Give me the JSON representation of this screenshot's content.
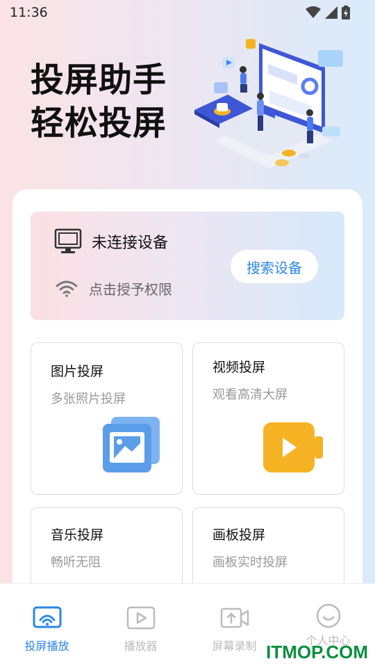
{
  "status_bar": {
    "time": "11:36"
  },
  "hero": {
    "line1": "投屏助手",
    "line2": "轻松投屏"
  },
  "device_panel": {
    "status": "未连接设备",
    "permission": "点击授予权限",
    "search_button": "搜索设备"
  },
  "features": [
    {
      "title": "图片投屏",
      "subtitle": "多张照片投屏",
      "icon": "photo-icon"
    },
    {
      "title": "视频投屏",
      "subtitle": "观看高清大屏",
      "icon": "video-icon"
    },
    {
      "title": "音乐投屏",
      "subtitle": "畅听无阻",
      "icon": "music-icon"
    },
    {
      "title": "画板投屏",
      "subtitle": "画板实时投屏",
      "icon": "drawing-icon"
    }
  ],
  "nav": [
    {
      "label": "投屏播放",
      "icon": "cast-icon",
      "active": true
    },
    {
      "label": "播放器",
      "icon": "player-icon",
      "active": false
    },
    {
      "label": "屏幕录制",
      "icon": "screen-record-icon",
      "active": false
    },
    {
      "label": "个人中心",
      "icon": "profile-icon",
      "active": false
    }
  ],
  "watermark": "ITMOP.COM",
  "colors": {
    "accent": "#2c86e8",
    "photo_icon": "#5b9de8",
    "video_icon": "#f5b324"
  }
}
